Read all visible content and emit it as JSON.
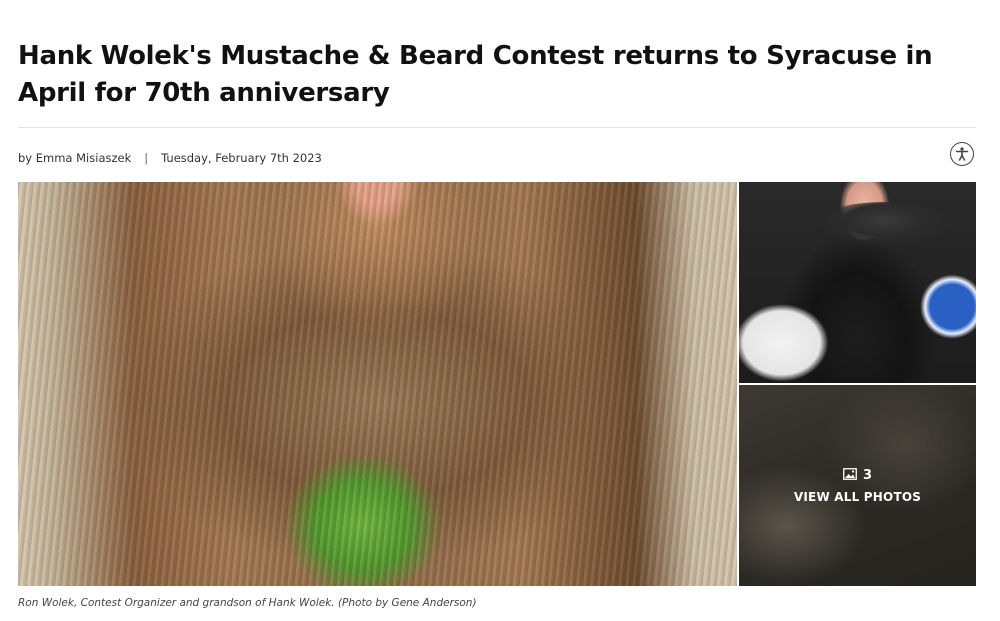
{
  "article": {
    "headline": "Hank Wolek's Mustache & Beard Contest returns to Syracuse in April for 70th anniversary",
    "byline": {
      "author": "by Emma Misiaszek",
      "separator": "|",
      "date": "Tuesday, February 7th 2023"
    },
    "accessibility_icon": "accessibility-icon"
  },
  "gallery": {
    "photo_count": "3",
    "photo_count_icon": "image-icon",
    "view_all_label": "VIEW ALL PHOTOS",
    "caption": "Ron Wolek, Contest Organizer and grandson of Hank Wolek. (Photo by Gene Anderson)"
  },
  "colors": {
    "text": "#111111",
    "divider": "#e2e2e2",
    "overlay_text": "#ffffff"
  }
}
